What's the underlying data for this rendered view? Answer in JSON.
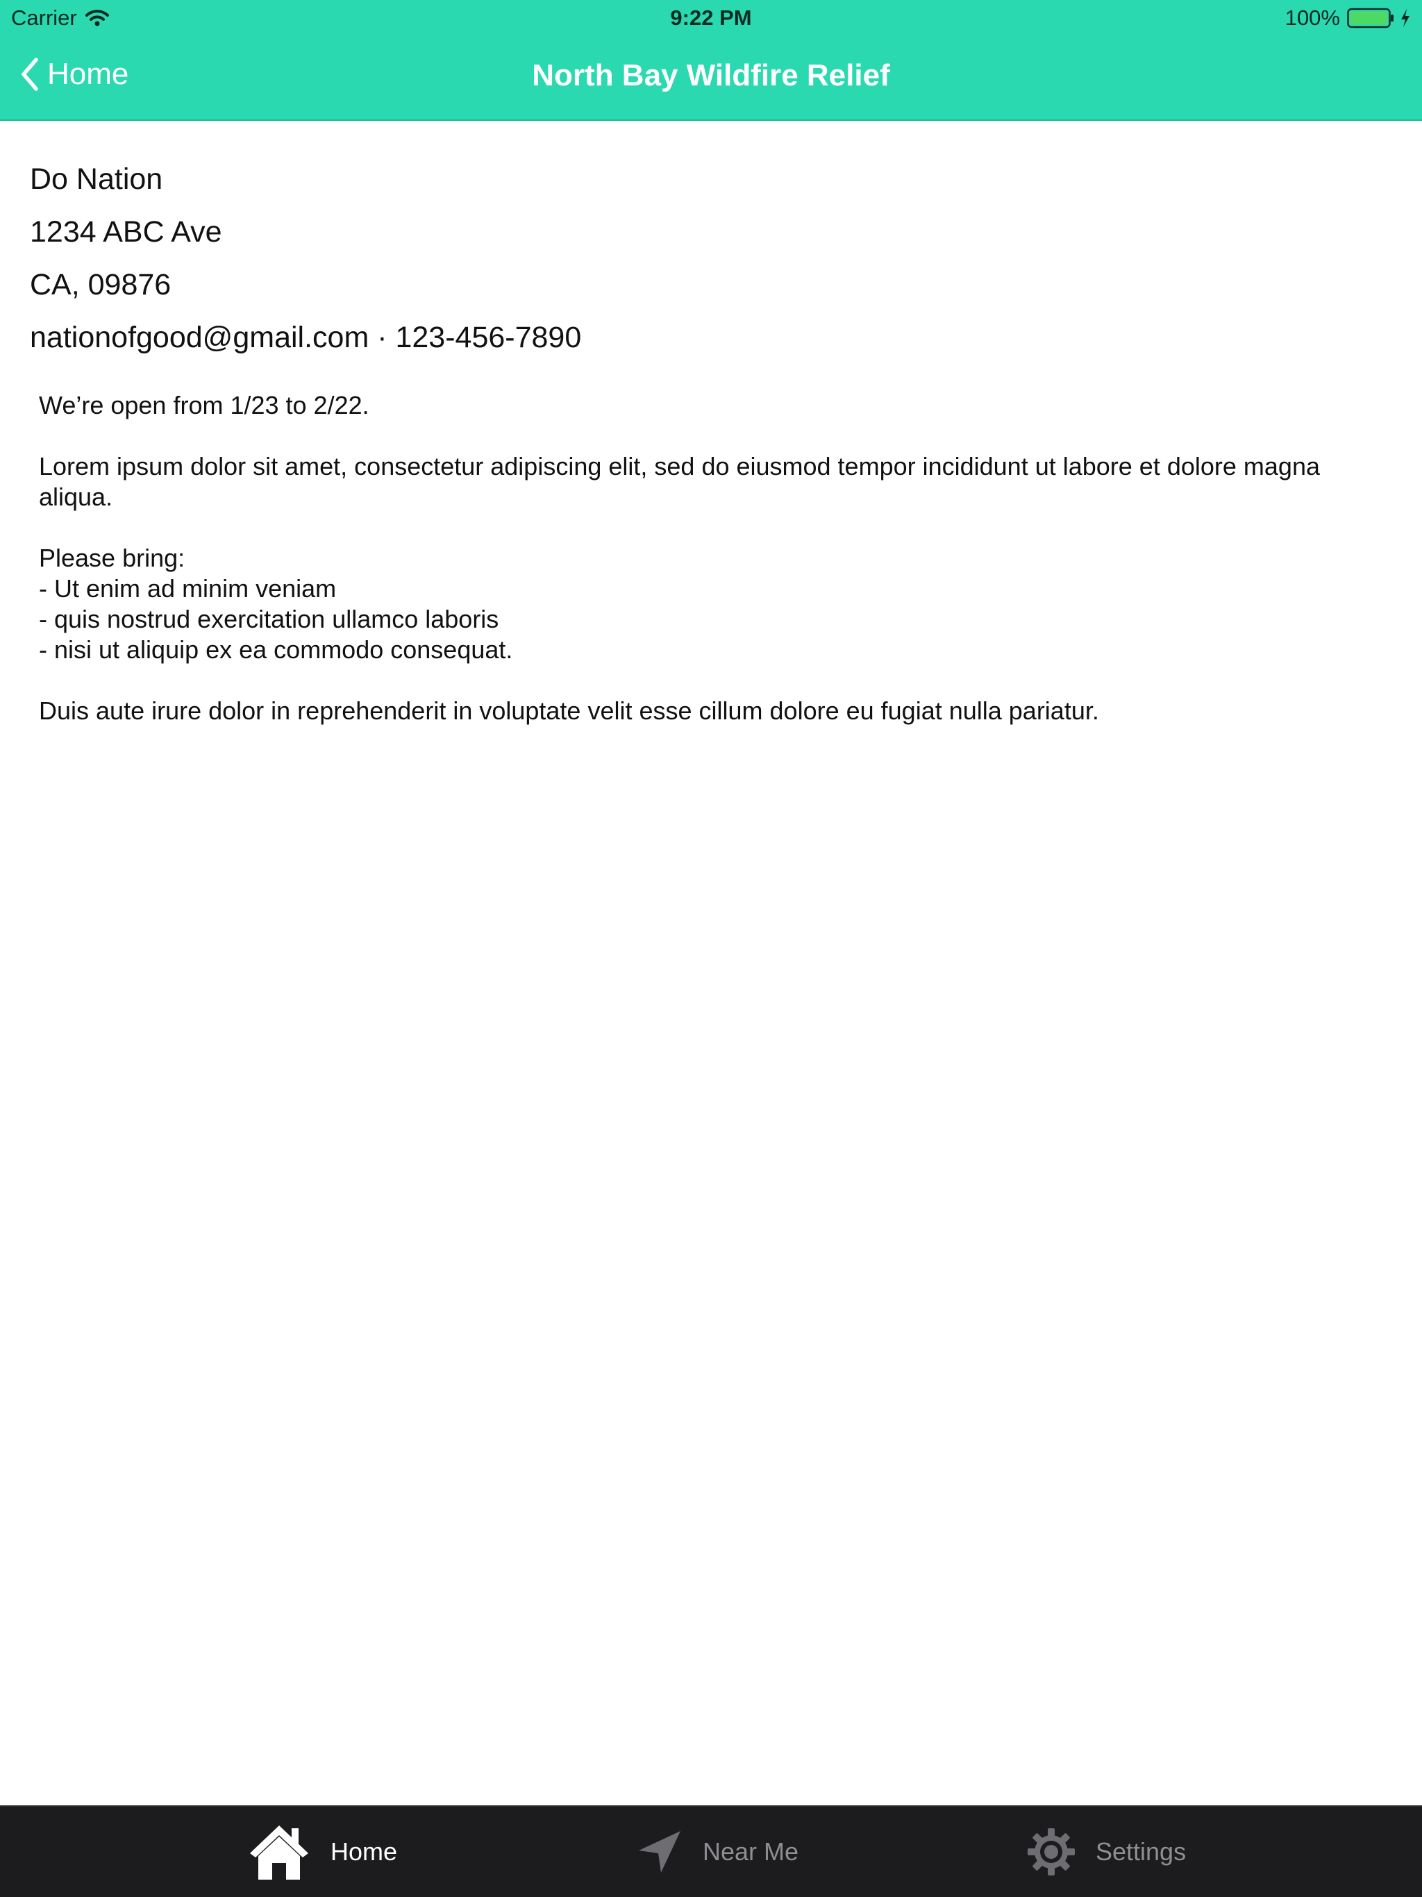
{
  "status_bar": {
    "carrier": "Carrier",
    "time": "9:22 PM",
    "battery": "100%",
    "icons": [
      "wifi-icon",
      "battery-icon",
      "charging-icon"
    ]
  },
  "nav": {
    "back_label": "Home",
    "title": "North Bay Wildfire Relief",
    "color": "#2bd9b0"
  },
  "contact": {
    "name": "Do Nation",
    "street": "1234 ABC Ave",
    "city": "CA, 09876",
    "email_phone": "nationofgood@gmail.com · 123-456-7890"
  },
  "description": {
    "open": "We’re open from 1/23 to 2/22.",
    "lorem": "Lorem ipsum dolor sit amet, consectetur adipiscing elit, sed do eiusmod tempor incididunt ut labore et dolore magna aliqua.",
    "bring_heading": "Please bring:",
    "bring_items": [
      "- Ut enim ad minim veniam",
      "- quis nostrud exercitation ullamco laboris",
      "- nisi ut aliquip ex ea commodo consequat."
    ],
    "closing": "Duis aute irure dolor in reprehenderit in voluptate velit esse cillum dolore eu fugiat nulla pariatur."
  },
  "tabs": [
    {
      "label": "Home",
      "icon": "home-icon",
      "active": true
    },
    {
      "label": "Near Me",
      "icon": "location-arrow-icon",
      "active": false
    },
    {
      "label": "Settings",
      "icon": "gear-icon",
      "active": false
    }
  ]
}
